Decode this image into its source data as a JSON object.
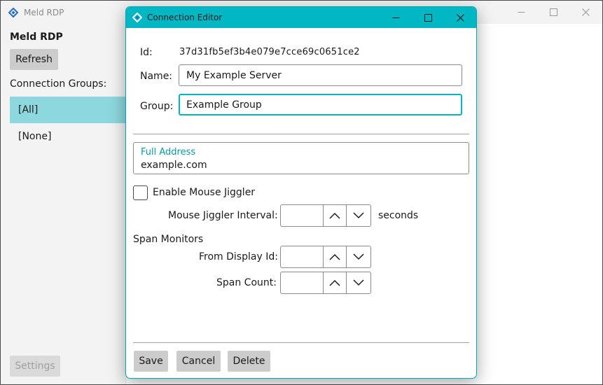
{
  "main_window": {
    "title": "Meld RDP",
    "heading": "Meld RDP",
    "refresh_label": "Refresh",
    "groups_label": "Connection Groups:",
    "groups": [
      "[All]",
      "[None]"
    ],
    "selected_group": "[All]",
    "settings_label": "Settings"
  },
  "dialog": {
    "title": "Connection Editor",
    "id_label": "Id:",
    "id_value": "37d31fb5ef3b4e079e7cce69c0651ce2",
    "name_label": "Name:",
    "name_value": "My Example Server",
    "group_label": "Group:",
    "group_value": "Example Group",
    "address_label": "Full Address",
    "address_value": "example.com",
    "mouse_jiggler_label": "Enable Mouse Jiggler",
    "mouse_jiggler_checked": false,
    "jiggler_interval_label": "Mouse Jiggler Interval:",
    "jiggler_interval_unit": "seconds",
    "span_monitors_label": "Span Monitors",
    "from_display_label": "From Display Id:",
    "span_count_label": "Span Count:",
    "save_label": "Save",
    "cancel_label": "Cancel",
    "delete_label": "Delete"
  },
  "colors": {
    "accent": "#00b7c3",
    "selection": "#8dd8de",
    "button": "#cccccc"
  },
  "icons": {
    "app": "diamond-app-icon",
    "minimize": "minimize-icon",
    "maximize": "maximize-icon",
    "close": "close-icon",
    "spin_up": "chevron-up-icon",
    "spin_down": "chevron-down-icon"
  }
}
